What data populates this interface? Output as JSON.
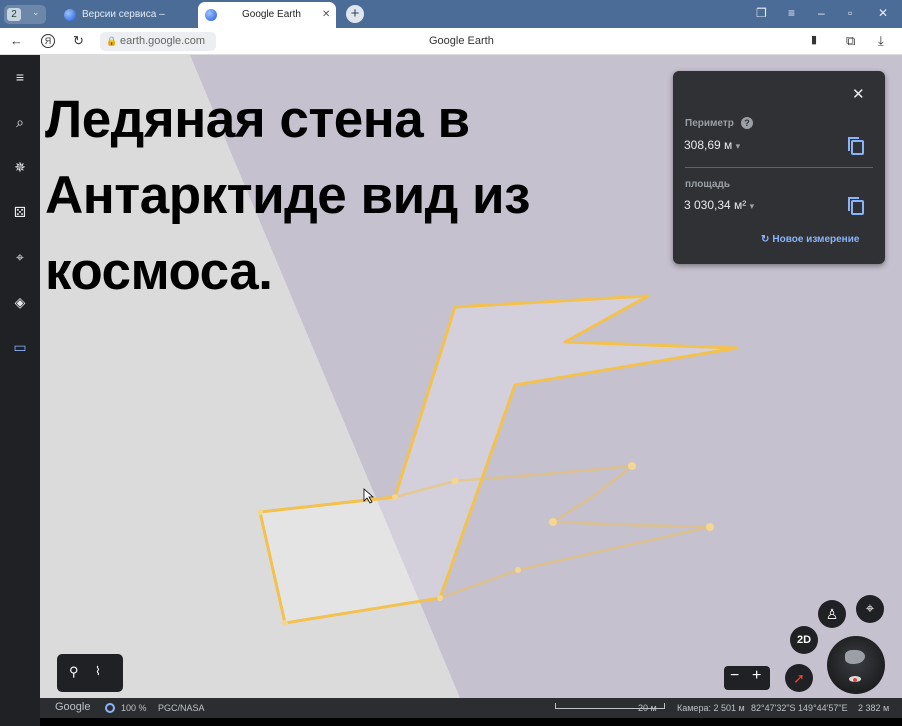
{
  "browser": {
    "tab_count": "2",
    "tabs": [
      {
        "label": "Версии сервиса – Google"
      },
      {
        "label": "Google Earth"
      }
    ],
    "url": "earth.google.com",
    "page_title": "Google Earth"
  },
  "sidebar": {
    "items": [
      "menu-icon",
      "search-icon",
      "voyager-icon",
      "dice-icon",
      "projects-icon",
      "layers-icon",
      "ruler-icon"
    ]
  },
  "overlay_title": "Ледяная стена в Антарктиде вид из космоса.",
  "measure": {
    "perimeter_label": "Периметр",
    "perimeter_value": "308,69 м",
    "area_label": "площадь",
    "area_value": "3 030,34 м²",
    "new_measurement": "Новое измерение"
  },
  "controls": {
    "mode_2d": "2D",
    "zoom_out": "−",
    "zoom_in": "+"
  },
  "status": {
    "logo": "Google",
    "progress": "100 %",
    "credits": "PGC/NASA",
    "scale": "20 м",
    "camera": "Камера: 2 501 м",
    "coords": "82°47'32\"S 149°44'57\"E",
    "elevation": "2 382 м"
  },
  "colors": {
    "path": "#f2c14e",
    "panel": "#303134",
    "accent": "#8ab4f8"
  }
}
